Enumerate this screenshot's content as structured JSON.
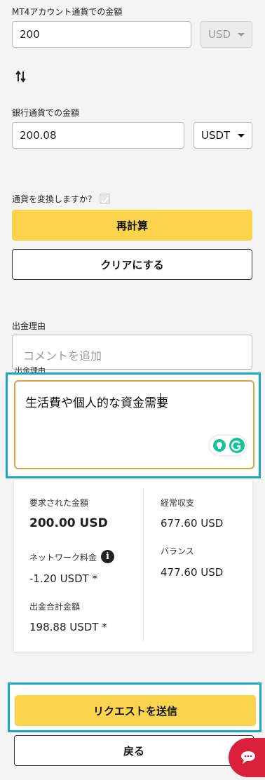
{
  "mt4": {
    "label": "MT4アカウント通貨での金額",
    "amount": "200",
    "currency": "USD"
  },
  "bank": {
    "label": "銀行通貨での金額",
    "amount": "200.08",
    "currency": "USDT"
  },
  "convert": {
    "label": "通貨を変換しますか？"
  },
  "buttons": {
    "recalculate": "再計算",
    "clear": "クリアにする",
    "submit": "リクエストを送信",
    "back": "戻る"
  },
  "withdrawal_reason": {
    "label": "出金理由",
    "placeholder": "コメントを追加",
    "floating_label": "出金理由",
    "value": "生活費や個人的な資金需要"
  },
  "summary": {
    "requested_label": "要求された金額",
    "requested_value": "200.00 USD",
    "network_fee_label": "ネットワーク料金",
    "network_fee_value": "-1.20 USDT *",
    "total_label": "出金合計金額",
    "total_value": "198.88 USDT *",
    "recurring_label": "経常収支",
    "recurring_value": "677.60 USD",
    "balance_label": "バランス",
    "balance_value": "477.60 USD"
  },
  "colors": {
    "accent_yellow": "#fcd34d",
    "highlight": "#19a7c4",
    "textarea_border": "#d9a43a",
    "chat_red": "#d9213b",
    "grammarly_green": "#15c39a"
  },
  "icons": {
    "swap": "swap-arrows-icon",
    "info": "info-icon",
    "chat": "chat-icon",
    "grammarly": "grammarly-icon",
    "bulb": "lightbulb-icon"
  }
}
